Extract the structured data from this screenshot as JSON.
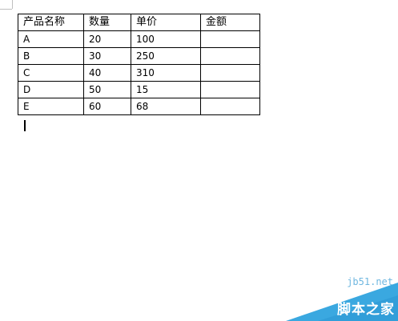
{
  "table": {
    "headers": [
      "产品名称",
      "数量",
      "单价",
      "金额"
    ],
    "rows": [
      [
        "A",
        "20",
        "100",
        ""
      ],
      [
        "B",
        "30",
        "250",
        ""
      ],
      [
        "C",
        "40",
        "310",
        ""
      ],
      [
        "D",
        "50",
        "15",
        ""
      ],
      [
        "E",
        "60",
        "68",
        ""
      ]
    ]
  },
  "watermark": {
    "domain": "jb51.net",
    "name": "脚本之家",
    "accent_color": "#3aa8e0"
  }
}
